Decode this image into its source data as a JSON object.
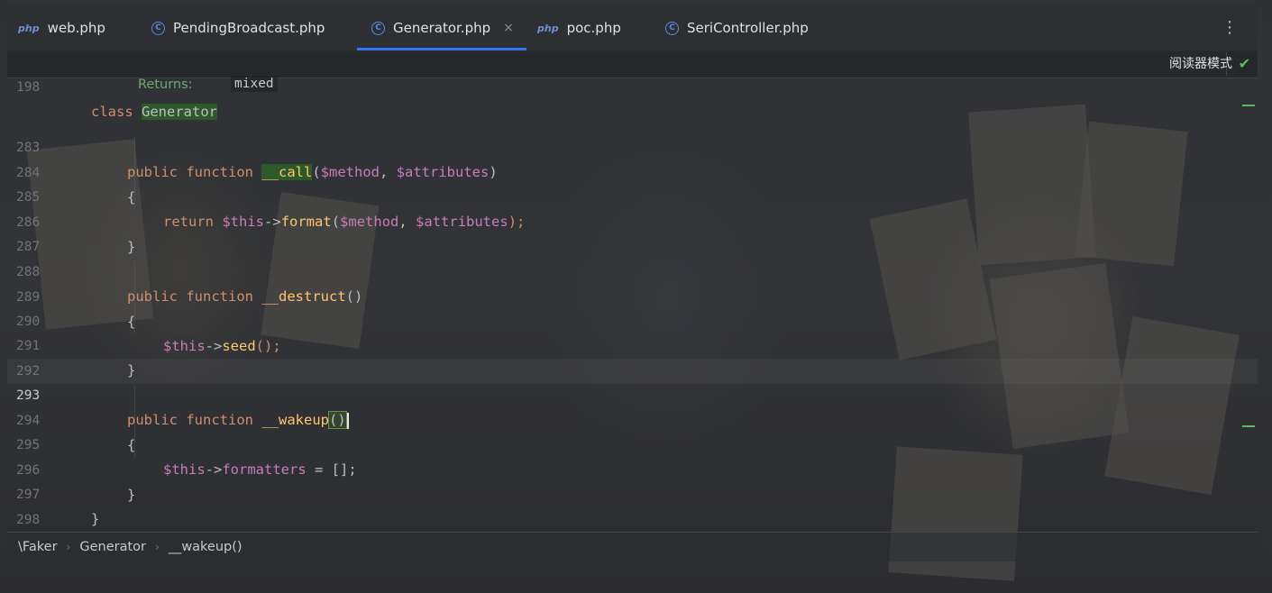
{
  "tabs": [
    {
      "label": "web.php",
      "icon": "php-file-icon",
      "active": false
    },
    {
      "label": "PendingBroadcast.php",
      "icon": "class-icon",
      "active": false
    },
    {
      "label": "Generator.php",
      "icon": "class-icon",
      "active": true
    },
    {
      "label": "poc.php",
      "icon": "php-file-icon",
      "active": false
    },
    {
      "label": "SeriController.php",
      "icon": "class-icon",
      "active": false
    }
  ],
  "tab_icon_text": {
    "php": "php",
    "class": "C",
    "close": "×",
    "more": "⋮"
  },
  "editor": {
    "sticky_line_number": "198",
    "sticky_class_keyword": "class",
    "sticky_class_name": "Generator",
    "hint_label": "Returns:",
    "hint_value": "mixed",
    "reader_mode_label": "阅读器模式",
    "reader_check": "✔",
    "lines": [
      {
        "n": "283",
        "kw1": "public",
        "kw2": "function",
        "name": "__call",
        "rest_open": "(",
        "arg1": "$method",
        "comma": ", ",
        "arg2": "$attributes",
        "rest_close": ")"
      },
      {
        "n": "284",
        "text": "{"
      },
      {
        "n": "285",
        "kw": "return",
        "this": "$this",
        "arrow": "->",
        "call": "format",
        "open": "(",
        "arg1": "$method",
        "comma": ", ",
        "arg2": "$attributes",
        "close": ");"
      },
      {
        "n": "286",
        "text": "}"
      },
      {
        "n": "287",
        "text": ""
      },
      {
        "n": "288",
        "kw1": "public",
        "kw2": "function",
        "name": "__destruct",
        "rest": "()"
      },
      {
        "n": "289",
        "text": "{"
      },
      {
        "n": "290",
        "this": "$this",
        "arrow": "->",
        "call": "seed",
        "rest": "();"
      },
      {
        "n": "291",
        "text": "}"
      },
      {
        "n": "292",
        "text": ""
      },
      {
        "n": "293",
        "kw1": "public",
        "kw2": "function",
        "name": "__wakeup",
        "rest": "()"
      },
      {
        "n": "294",
        "text": "{"
      },
      {
        "n": "295",
        "this": "$this",
        "arrow": "->",
        "prop": "formatters",
        "rest": " = [];"
      },
      {
        "n": "296",
        "text": "}"
      },
      {
        "n": "297",
        "text": "}"
      },
      {
        "n": "298",
        "text": ""
      }
    ]
  },
  "breadcrumb": [
    "\\Faker",
    "Generator",
    "__wakeup()"
  ],
  "breadcrumb_sep": "›",
  "colors": {
    "keyword": "#cf8e6d",
    "method": "#ffc66d",
    "variable": "#c77dbb",
    "accent": "#3574f0"
  }
}
